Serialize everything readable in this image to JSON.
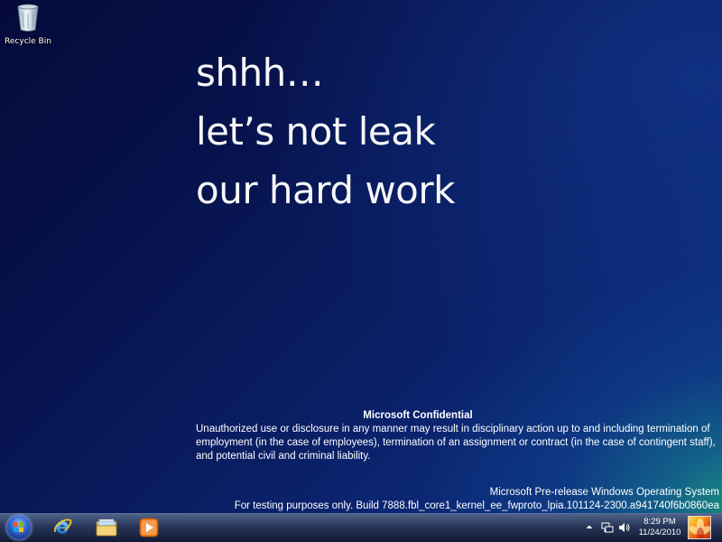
{
  "desktop": {
    "icons": [
      {
        "label": "Recycle Bin",
        "icon": "recycle-bin-icon"
      }
    ],
    "headline": [
      "shhh…",
      "let’s not leak",
      "our hard work"
    ],
    "confidential": {
      "title": "Microsoft Confidential",
      "body": "Unauthorized use or disclosure in any manner may result in disciplinary action up to and including termination of employment (in the case of employees), termination of an assignment or contract (in the case of contingent staff), and potential civil and criminal liability."
    },
    "prerelease": {
      "line1": "Microsoft Pre-release Windows Operating System",
      "line2": "For testing purposes only. Build 7888.fbl_core1_kernel_ee_fwproto_lpia.101124-2300.a941740f6b0860ea"
    }
  },
  "taskbar": {
    "start_icon": "windows-flag-icon",
    "pinned": [
      {
        "name": "Internet Explorer",
        "icon": "internet-explorer-icon"
      },
      {
        "name": "Windows Explorer",
        "icon": "folder-library-icon"
      },
      {
        "name": "Windows Media Player",
        "icon": "media-player-icon"
      }
    ],
    "tray": {
      "icons": [
        "show-hidden-icons-arrow-icon",
        "network-icon",
        "volume-icon"
      ],
      "time": "8:29 PM",
      "date": "11/24/2010"
    }
  },
  "colors": {
    "desktop_dark": "#050a3a",
    "desktop_teal": "#1c9678",
    "text": "#ffffff"
  }
}
